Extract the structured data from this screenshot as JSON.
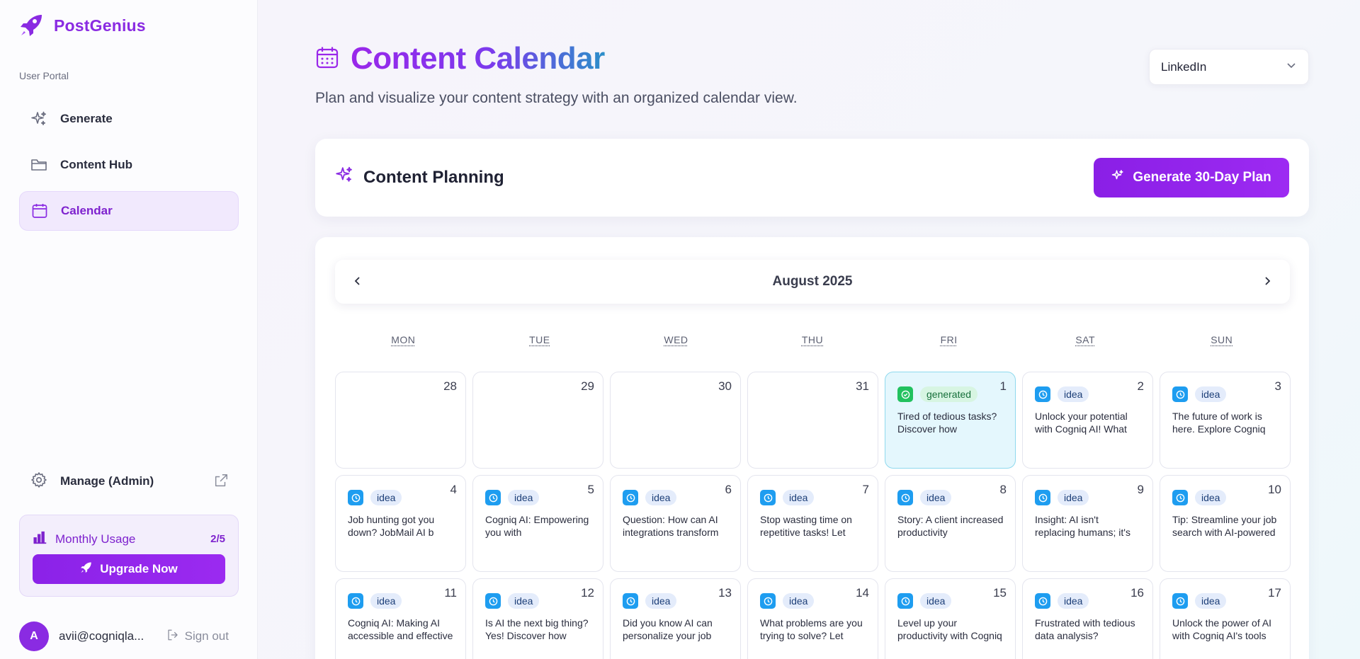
{
  "brand": {
    "name": "PostGenius"
  },
  "sidebar": {
    "portal_label": "User Portal",
    "items": [
      {
        "label": "Generate",
        "icon": "sparkles-icon"
      },
      {
        "label": "Content Hub",
        "icon": "folder-icon"
      },
      {
        "label": "Calendar",
        "icon": "calendar-icon",
        "active": true
      }
    ],
    "manage": {
      "label": "Manage (Admin)",
      "icon": "gear-icon"
    },
    "usage": {
      "title": "Monthly Usage",
      "count": "2/5",
      "upgrade_label": "Upgrade Now"
    },
    "user": {
      "initial": "A",
      "email": "avii@cogniqla...",
      "signout_label": "Sign out"
    }
  },
  "header": {
    "title": "Content Calendar",
    "subtitle": "Plan and visualize your content strategy with an organized calendar view.",
    "platform": "LinkedIn"
  },
  "planning": {
    "title": "Content Planning",
    "button_label": "Generate 30-Day Plan"
  },
  "calendar": {
    "month_label": "August 2025",
    "days_of_week": [
      "MON",
      "TUE",
      "WED",
      "THU",
      "FRI",
      "SAT",
      "SUN"
    ],
    "weeks": [
      [
        {
          "day": "28"
        },
        {
          "day": "29"
        },
        {
          "day": "30"
        },
        {
          "day": "31"
        },
        {
          "day": "1",
          "status": "generated",
          "text": "Tired of tedious tasks? Discover how"
        },
        {
          "day": "2",
          "status": "idea",
          "text": "Unlock your potential with Cogniq AI! What"
        },
        {
          "day": "3",
          "status": "idea",
          "text": "The future of work is here. Explore Cogniq"
        }
      ],
      [
        {
          "day": "4",
          "status": "idea",
          "text": "Job hunting got you down? JobMail AI b"
        },
        {
          "day": "5",
          "status": "idea",
          "text": "Cogniq AI: Empowering you with"
        },
        {
          "day": "6",
          "status": "idea",
          "text": "Question: How can AI integrations transform"
        },
        {
          "day": "7",
          "status": "idea",
          "text": "Stop wasting time on repetitive tasks! Let"
        },
        {
          "day": "8",
          "status": "idea",
          "text": "Story: A client increased productivity"
        },
        {
          "day": "9",
          "status": "idea",
          "text": "Insight: AI isn't replacing humans; it's"
        },
        {
          "day": "10",
          "status": "idea",
          "text": "Tip: Streamline your job search with AI-powered"
        }
      ],
      [
        {
          "day": "11",
          "status": "idea",
          "text": "Cogniq AI: Making AI accessible and effective"
        },
        {
          "day": "12",
          "status": "idea",
          "text": "Is AI the next big thing? Yes! Discover how"
        },
        {
          "day": "13",
          "status": "idea",
          "text": "Did you know AI can personalize your job"
        },
        {
          "day": "14",
          "status": "idea",
          "text": "What problems are you trying to solve? Let"
        },
        {
          "day": "15",
          "status": "idea",
          "text": "Level up your productivity with Cogniq"
        },
        {
          "day": "16",
          "status": "idea",
          "text": "Frustrated with tedious data analysis?"
        },
        {
          "day": "17",
          "status": "idea",
          "text": "Unlock the power of AI with Cogniq AI's tools"
        }
      ]
    ]
  },
  "colors": {
    "accent": "#8a2be2",
    "idea": "#1e9df0",
    "generated": "#22c15e",
    "highlight": "#e4f7fd"
  }
}
